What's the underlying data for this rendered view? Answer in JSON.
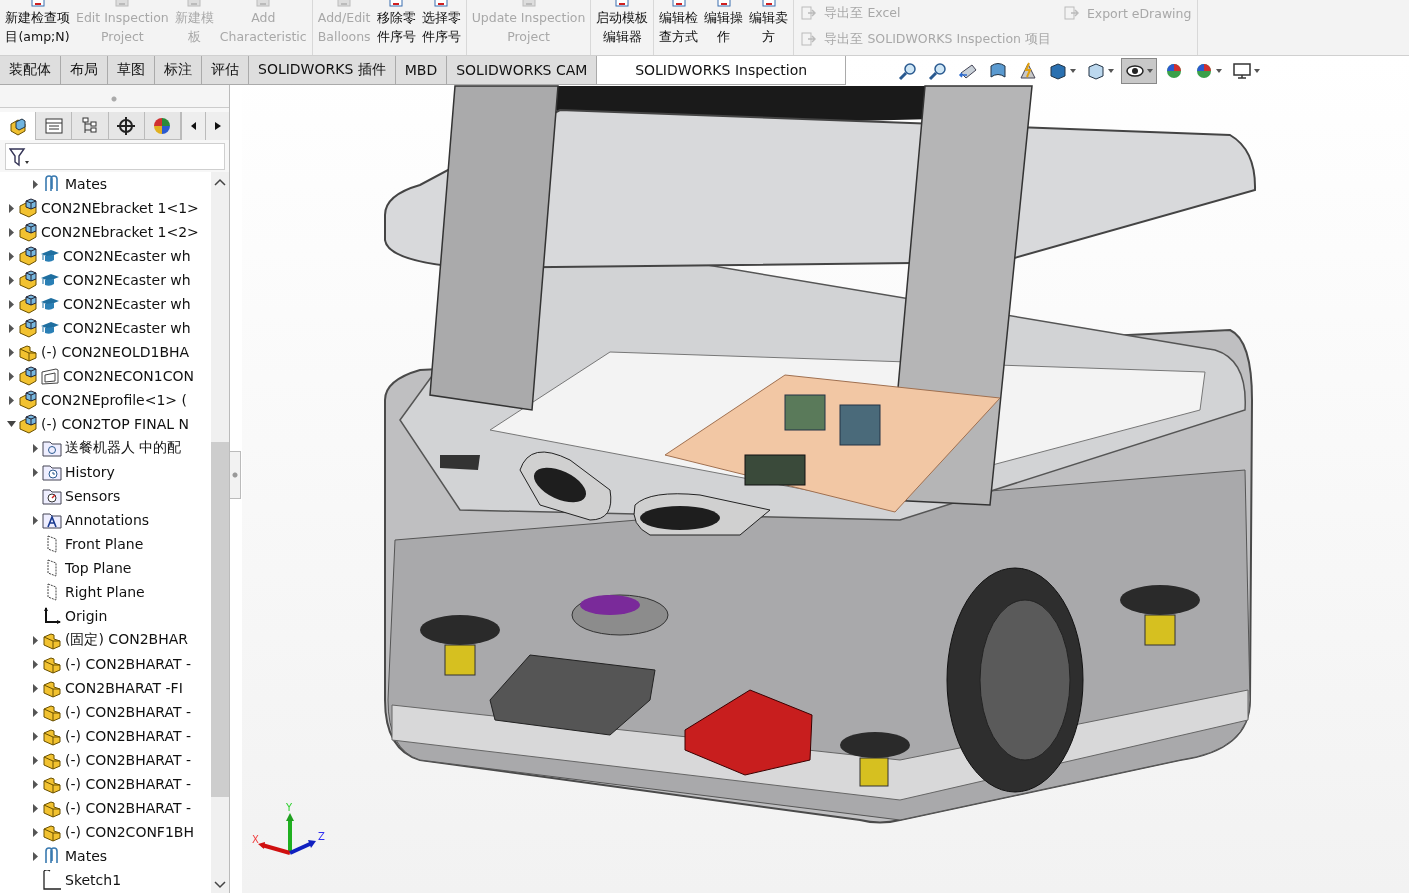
{
  "ribbon_groups": [
    {
      "buttons": [
        {
          "lines": [
            "新建检查项",
            "目(amp;N)"
          ],
          "disabled": false
        },
        {
          "lines": [
            "Edit Inspection",
            "Project"
          ],
          "disabled": true
        },
        {
          "lines": [
            "新建模",
            "板"
          ],
          "disabled": true
        },
        {
          "lines": [
            "Add",
            "Characteristic"
          ],
          "disabled": true
        }
      ]
    },
    {
      "buttons": [
        {
          "lines": [
            "Add/Edit",
            "Balloons"
          ],
          "disabled": true
        },
        {
          "lines": [
            "移除零",
            "件序号"
          ],
          "disabled": false
        },
        {
          "lines": [
            "选择零",
            "件序号"
          ],
          "disabled": false
        }
      ]
    },
    {
      "buttons": [
        {
          "lines": [
            "Update Inspection",
            "Project"
          ],
          "disabled": true
        }
      ]
    },
    {
      "buttons": [
        {
          "lines": [
            "启动模板",
            "编辑器"
          ],
          "disabled": false
        }
      ]
    },
    {
      "buttons": [
        {
          "lines": [
            "编辑检",
            "查方式"
          ],
          "disabled": false
        },
        {
          "lines": [
            "编辑操",
            "作"
          ],
          "disabled": false
        },
        {
          "lines": [
            "编辑卖",
            "方"
          ],
          "disabled": false
        }
      ]
    }
  ],
  "export_items": [
    {
      "label": "导出至 Excel",
      "disabled": true
    },
    {
      "label": "导出至 SOLIDWORKS Inspection 项目",
      "disabled": true
    }
  ],
  "export_edrawing": {
    "label": "Export eDrawing",
    "disabled": true
  },
  "tabs": [
    {
      "label": "装配体",
      "selected": false
    },
    {
      "label": "布局",
      "selected": false
    },
    {
      "label": "草图",
      "selected": false
    },
    {
      "label": "标注",
      "selected": false
    },
    {
      "label": "评估",
      "selected": false
    },
    {
      "label": "SOLIDWORKS 插件",
      "selected": false
    },
    {
      "label": "MBD",
      "selected": false
    },
    {
      "label": "SOLIDWORKS CAM",
      "selected": false
    },
    {
      "label": "SOLIDWORKS Inspection",
      "selected": true
    }
  ],
  "view_tools": [
    {
      "kind": "zoom-fit",
      "dropdown": false,
      "selected": false
    },
    {
      "kind": "zoom-area",
      "dropdown": false,
      "selected": false
    },
    {
      "kind": "previous-view",
      "dropdown": false,
      "selected": false
    },
    {
      "kind": "section",
      "dropdown": false,
      "selected": false
    },
    {
      "kind": "dynamic",
      "dropdown": false,
      "selected": false
    },
    {
      "kind": "orientation",
      "dropdown": true,
      "selected": false
    },
    {
      "kind": "display-style",
      "dropdown": true,
      "selected": false
    },
    {
      "kind": "hide-show",
      "dropdown": true,
      "selected": true
    },
    {
      "kind": "edit-appearance",
      "dropdown": false,
      "selected": false
    },
    {
      "kind": "scene",
      "dropdown": true,
      "selected": false
    },
    {
      "kind": "view-settings",
      "dropdown": true,
      "selected": false
    }
  ],
  "panel_tabs": [
    {
      "kind": "feature-tree",
      "selected": true
    },
    {
      "kind": "property",
      "selected": false
    },
    {
      "kind": "configuration",
      "selected": false
    },
    {
      "kind": "dimxpert",
      "selected": false
    },
    {
      "kind": "display",
      "selected": false
    }
  ],
  "tree": {
    "continued_children": [
      {
        "label": "Mates",
        "kind": "mates",
        "expandable": true,
        "expanded": false
      }
    ],
    "items": [
      {
        "label": "CON2NEbracket 1<1>",
        "kind": "assembly",
        "expandable": true,
        "expanded": false
      },
      {
        "label": "CON2NEbracket 1<2>",
        "kind": "assembly",
        "expandable": true,
        "expanded": false
      },
      {
        "label": "CON2NEcaster wh",
        "kind": "assembly",
        "badge": {
          "kind": "cap"
        },
        "expandable": true,
        "expanded": false
      },
      {
        "label": "CON2NEcaster wh",
        "kind": "assembly",
        "badge": {
          "kind": "cap"
        },
        "expandable": true,
        "expanded": false
      },
      {
        "label": "CON2NEcaster wh",
        "kind": "assembly",
        "badge": {
          "kind": "cap"
        },
        "expandable": true,
        "expanded": false
      },
      {
        "label": "CON2NEcaster wh",
        "kind": "assembly",
        "badge": {
          "kind": "cap"
        },
        "expandable": true,
        "expanded": false
      },
      {
        "label": "(-) CON2NEOLD1BHA",
        "kind": "part",
        "expandable": true,
        "expanded": false
      },
      {
        "label": "CON2NECON1CON",
        "kind": "assembly",
        "badge": {
          "kind": "frame"
        },
        "expandable": true,
        "expanded": false
      },
      {
        "label": "CON2NEprofile<1> (",
        "kind": "assembly",
        "expandable": true,
        "expanded": false
      },
      {
        "label": "(-) CON2TOP FINAL N",
        "kind": "assembly",
        "expandable": true,
        "expanded": true,
        "children": [
          {
            "label": "送餐机器人 中的配",
            "kind": "mate-folder",
            "expandable": true,
            "expanded": false
          },
          {
            "label": "History",
            "kind": "history",
            "expandable": true,
            "expanded": false
          },
          {
            "label": "Sensors",
            "kind": "sensors",
            "expandable": false
          },
          {
            "label": "Annotations",
            "kind": "annotations",
            "expandable": true,
            "expanded": false
          },
          {
            "label": "Front Plane",
            "kind": "plane",
            "expandable": false
          },
          {
            "label": "Top Plane",
            "kind": "plane",
            "expandable": false
          },
          {
            "label": "Right Plane",
            "kind": "plane",
            "expandable": false
          },
          {
            "label": "Origin",
            "kind": "origin",
            "expandable": false
          },
          {
            "label": "(固定) CON2BHAR",
            "kind": "part",
            "expandable": true,
            "expanded": false
          },
          {
            "label": "(-) CON2BHARAT -",
            "kind": "part",
            "expandable": true,
            "expanded": false
          },
          {
            "label": "CON2BHARAT -FI",
            "kind": "part",
            "expandable": true,
            "expanded": false
          },
          {
            "label": "(-) CON2BHARAT -",
            "kind": "part",
            "expandable": true,
            "expanded": false
          },
          {
            "label": "(-) CON2BHARAT -",
            "kind": "part",
            "expandable": true,
            "expanded": false
          },
          {
            "label": "(-) CON2BHARAT -",
            "kind": "part",
            "expandable": true,
            "expanded": false
          },
          {
            "label": "(-) CON2BHARAT -",
            "kind": "part",
            "expandable": true,
            "expanded": false
          },
          {
            "label": "(-) CON2BHARAT -",
            "kind": "part",
            "expandable": true,
            "expanded": false
          },
          {
            "label": "(-) CON2CONF1BH",
            "kind": "part",
            "expandable": true,
            "expanded": false
          },
          {
            "label": "Mates",
            "kind": "mates",
            "expandable": true,
            "expanded": false
          },
          {
            "label": "Sketch1",
            "kind": "sketch",
            "expandable": false
          }
        ]
      }
    ]
  },
  "triad": {
    "x": "X",
    "y": "Y",
    "z": "Z"
  }
}
